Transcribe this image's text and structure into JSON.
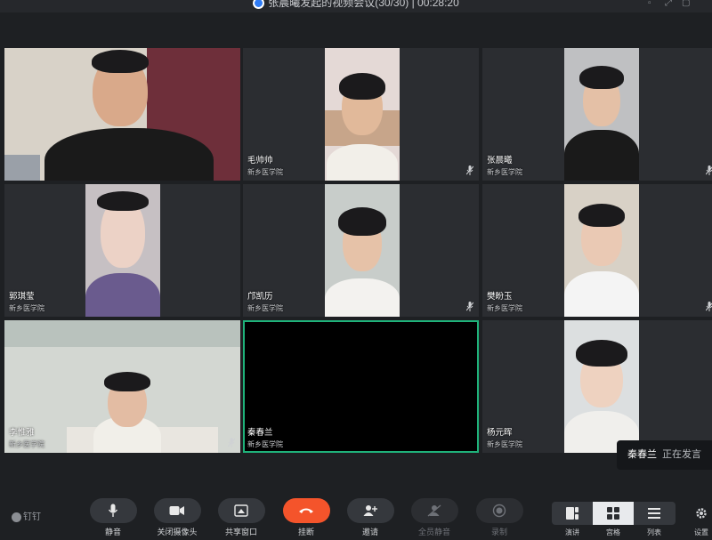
{
  "window": {
    "title": "张晨曦发起的视频会议(30/30) | 00:28:20"
  },
  "participants": [
    {
      "name": "",
      "org": "",
      "muted": false
    },
    {
      "name": "毛帅帅",
      "org": "新乡医学院",
      "muted": true
    },
    {
      "name": "张晨曦",
      "org": "新乡医学院",
      "muted": true
    },
    {
      "name": "郭琪莹",
      "org": "新乡医学院",
      "muted": false
    },
    {
      "name": "邝凯历",
      "org": "新乡医学院",
      "muted": true
    },
    {
      "name": "樊盼玉",
      "org": "新乡医学院",
      "muted": true
    },
    {
      "name": "李惟雅",
      "org": "新乡医学院",
      "muted": true
    },
    {
      "name": "秦春兰",
      "org": "新乡医学院",
      "muted": false
    },
    {
      "name": "杨元晖",
      "org": "新乡医学院",
      "muted": false
    }
  ],
  "speaking": {
    "name": "秦春兰",
    "text": "正在发言"
  },
  "toolbar": {
    "brand": "钉钉",
    "buttons": [
      {
        "label": "静音",
        "icon": "microphone-icon"
      },
      {
        "label": "关闭摄像头",
        "icon": "camera-icon"
      },
      {
        "label": "共享窗口",
        "icon": "share-screen-icon"
      },
      {
        "label": "挂断",
        "icon": "hang-up-icon"
      },
      {
        "label": "邀请",
        "icon": "invite-user-icon"
      },
      {
        "label": "全员静音",
        "icon": "mute-all-icon"
      },
      {
        "label": "录制",
        "icon": "record-icon"
      }
    ],
    "layouts": [
      {
        "label": "演讲",
        "icon": "speaker-layout-icon"
      },
      {
        "label": "宫格",
        "icon": "grid-layout-icon"
      },
      {
        "label": "列表",
        "icon": "list-layout-icon"
      }
    ],
    "selected_layout": "宫格",
    "settings_label": "设置"
  },
  "colors": {
    "background": "#1e2023",
    "tile": "#2b2d31",
    "active_speaker_border": "#1fb27a",
    "hang_up": "#f4542b"
  }
}
